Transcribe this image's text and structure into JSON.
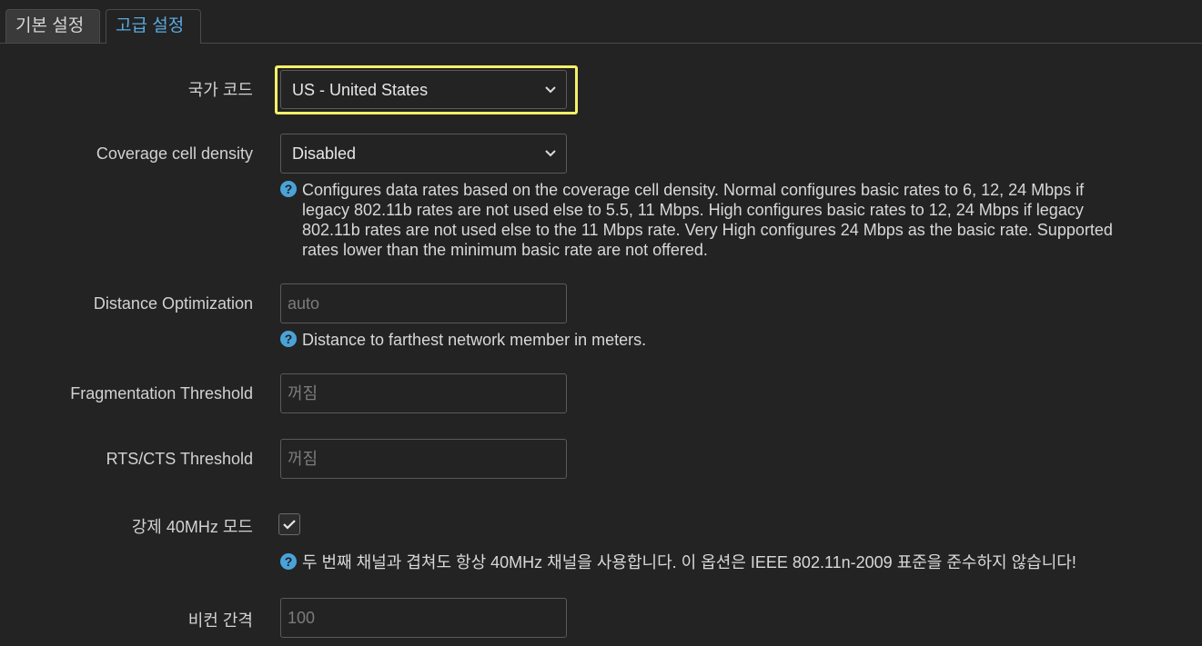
{
  "tabs": {
    "basic": "기본 설정",
    "advanced": "고급 설정"
  },
  "country_code": {
    "label": "국가 코드",
    "value": "US - United States"
  },
  "coverage_cell_density": {
    "label": "Coverage cell density",
    "value": "Disabled",
    "help_lines": [
      "Configures data rates based on the coverage cell density. Normal configures basic rates to 6, 12, 24 Mbps if",
      "legacy 802.11b rates are not used else to 5.5, 11 Mbps. High configures basic rates to 12, 24 Mbps if legacy",
      "802.11b rates are not used else to the 11 Mbps rate. Very High configures 24 Mbps as the basic rate. Supported",
      "rates lower than the minimum basic rate are not offered."
    ]
  },
  "distance_optimization": {
    "label": "Distance Optimization",
    "placeholder": "auto",
    "help": "Distance to farthest network member in meters."
  },
  "fragmentation_threshold": {
    "label": "Fragmentation Threshold",
    "placeholder": "꺼짐"
  },
  "rts_cts_threshold": {
    "label": "RTS/CTS Threshold",
    "placeholder": "꺼짐"
  },
  "force_40mhz": {
    "label": "강제 40MHz 모드",
    "checked": true,
    "help": "두 번째 채널과 겹쳐도 항상 40MHz 채널을 사용합니다. 이 옵션은 IEEE 802.11n-2009 표준을 준수하지 않습니다!"
  },
  "beacon_interval": {
    "label": "비컨 간격",
    "placeholder": "100"
  },
  "icons": {
    "help": "question-circle",
    "chevron": "chevron-down",
    "check": "checkmark"
  },
  "colors": {
    "background": "#232323",
    "active_tab_text": "#5aaadf",
    "help_icon": "#4aa3d8",
    "focus_ring": "#f5f068"
  }
}
